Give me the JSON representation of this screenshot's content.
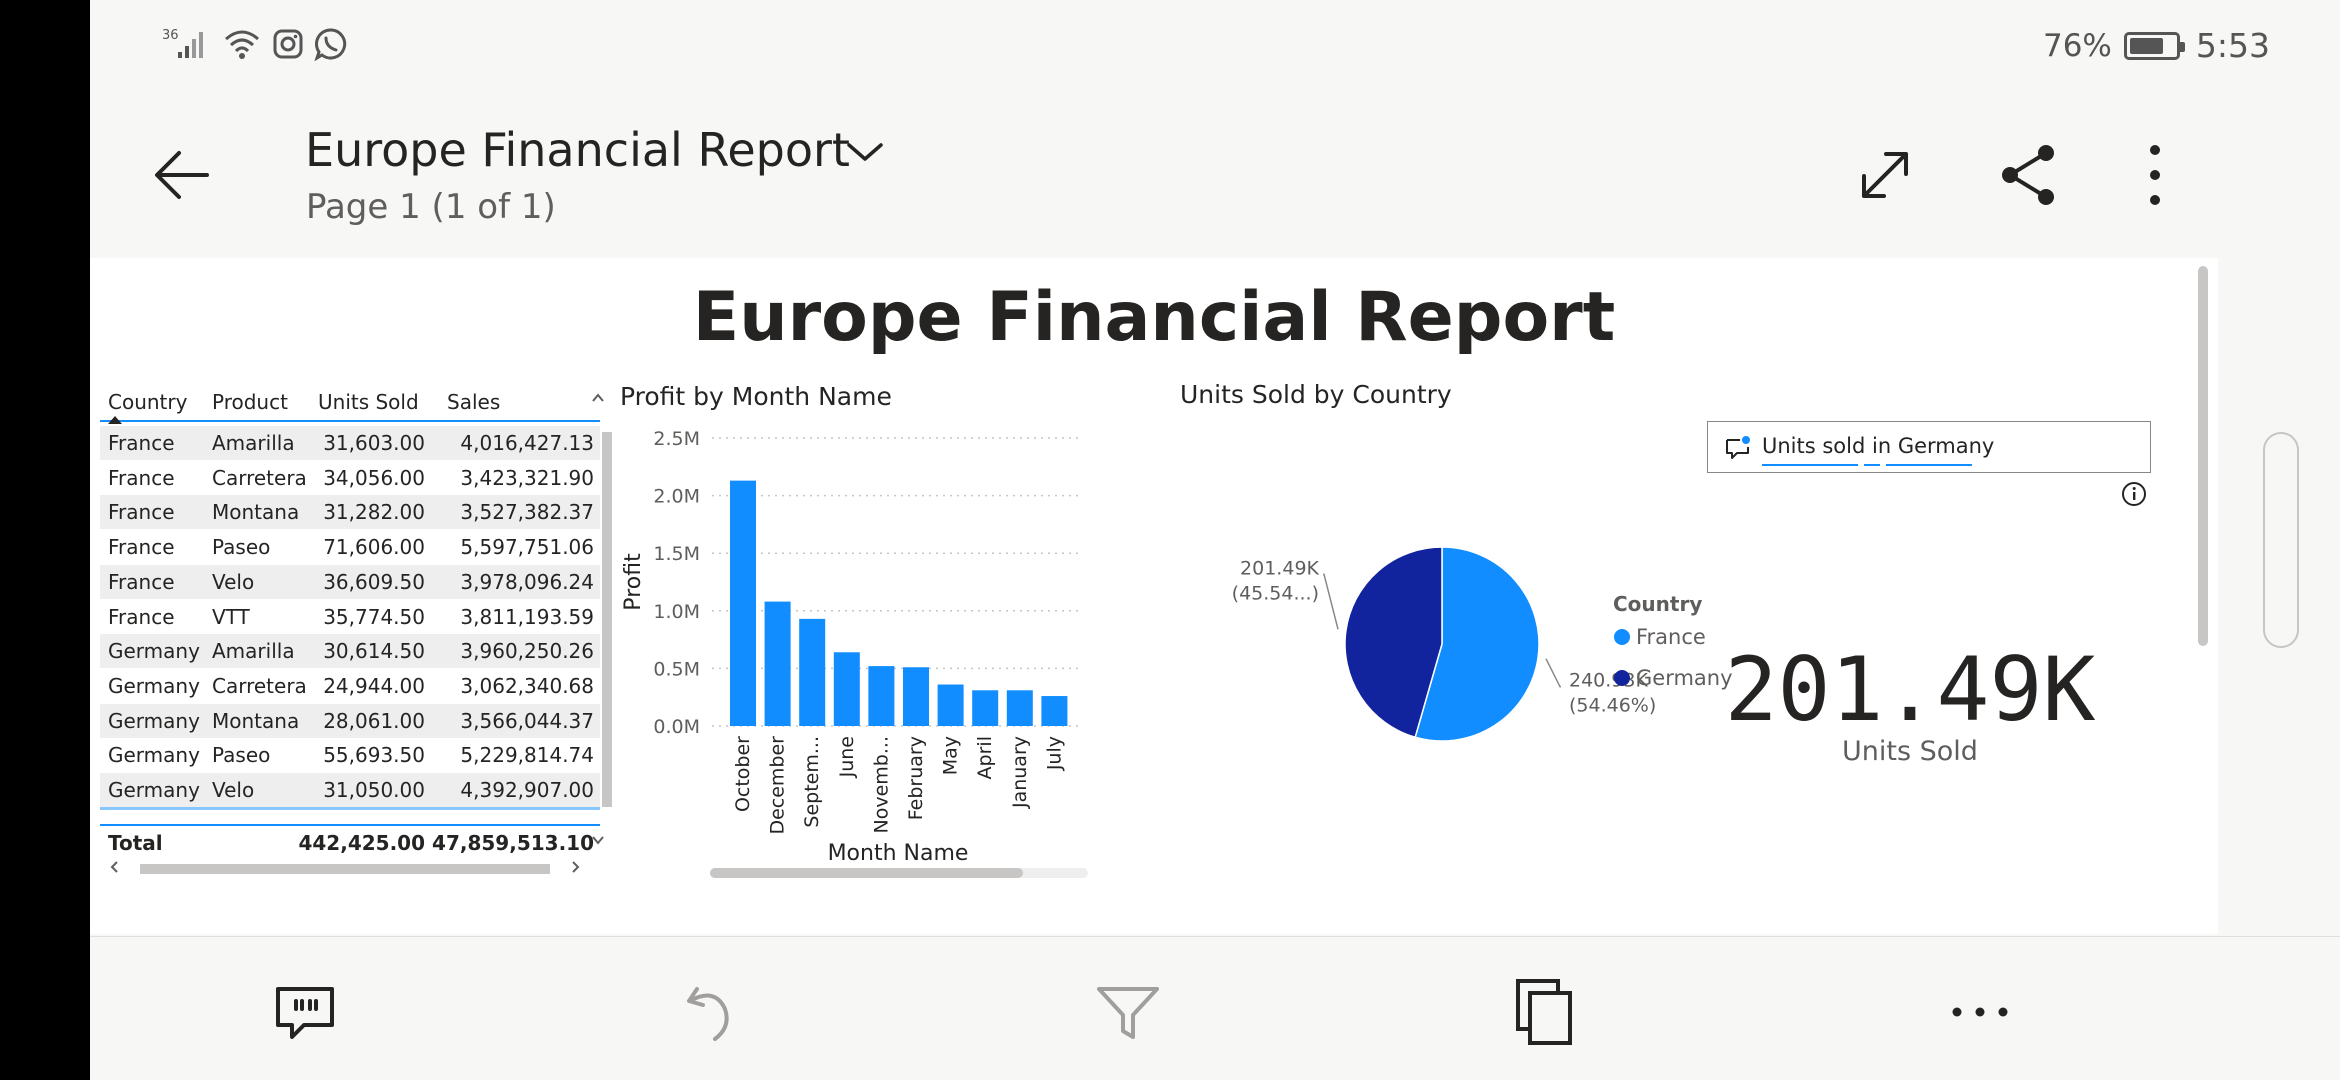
{
  "status_bar": {
    "network": "36",
    "battery": "76%",
    "battery_level": 0.76,
    "time": "5:53"
  },
  "header": {
    "title": "Europe Financial Report",
    "page": "Page 1 (1 of 1)"
  },
  "report": {
    "title": "Europe Financial Report"
  },
  "table": {
    "columns": [
      "Country",
      "Product",
      "Units Sold",
      "Sales"
    ],
    "rows": [
      [
        "France",
        "Amarilla",
        "31,603.00",
        "4,016,427.13"
      ],
      [
        "France",
        "Carretera",
        "34,056.00",
        "3,423,321.90"
      ],
      [
        "France",
        "Montana",
        "31,282.00",
        "3,527,382.37"
      ],
      [
        "France",
        "Paseo",
        "71,606.00",
        "5,597,751.06"
      ],
      [
        "France",
        "Velo",
        "36,609.50",
        "3,978,096.24"
      ],
      [
        "France",
        "VTT",
        "35,774.50",
        "3,811,193.59"
      ],
      [
        "Germany",
        "Amarilla",
        "30,614.50",
        "3,960,250.26"
      ],
      [
        "Germany",
        "Carretera",
        "24,944.00",
        "3,062,340.68"
      ],
      [
        "Germany",
        "Montana",
        "28,061.00",
        "3,566,044.37"
      ],
      [
        "Germany",
        "Paseo",
        "55,693.50",
        "5,229,814.74"
      ],
      [
        "Germany",
        "Velo",
        "31,050.00",
        "4,392,907.00"
      ]
    ],
    "total": {
      "label": "Total",
      "units": "442,425.00",
      "sales": "47,859,513.10"
    }
  },
  "chart_data": [
    {
      "type": "bar",
      "title": "Profit by Month Name",
      "xlabel": "Month Name",
      "ylabel": "Profit",
      "categories": [
        "October",
        "December",
        "Septem...",
        "June",
        "Novemb...",
        "February",
        "May",
        "April",
        "January",
        "July"
      ],
      "values": [
        2.13,
        1.08,
        0.93,
        0.64,
        0.52,
        0.51,
        0.36,
        0.31,
        0.31,
        0.26
      ],
      "value_unit": "M",
      "ylim": [
        0,
        2.5
      ],
      "yticks": [
        "0.0M",
        "0.5M",
        "1.0M",
        "1.5M",
        "2.0M",
        "2.5M"
      ],
      "color": "#118dff",
      "grid": true
    },
    {
      "type": "pie",
      "title": "Units Sold by Country",
      "legend_title": "Country",
      "legend_position": "right",
      "slices": [
        {
          "label": "France",
          "value": 240.93,
          "display": "240.93K",
          "pct": "(54.46%)",
          "color": "#118dff"
        },
        {
          "label": "Germany",
          "value": 201.49,
          "display": "201.49K",
          "pct": "(45.54...)",
          "color": "#12239e"
        }
      ]
    }
  ],
  "qna": {
    "query": "Units sold in Germany"
  },
  "card": {
    "value": "201.49K",
    "label": "Units Sold"
  }
}
